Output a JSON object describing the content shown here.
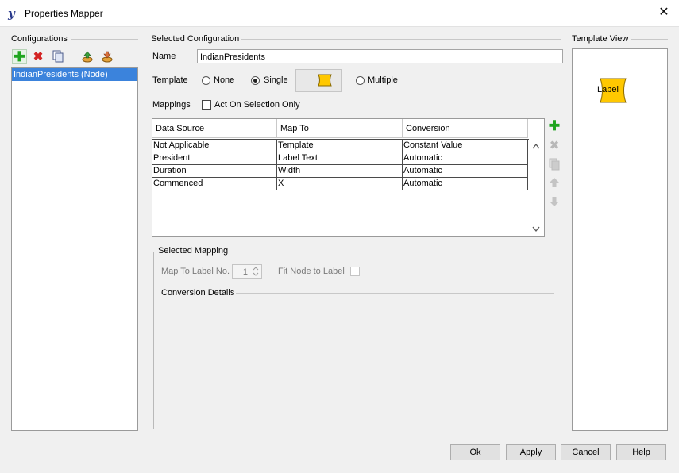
{
  "window": {
    "title": "Properties Mapper",
    "app_icon": "yworks-y-icon",
    "close_glyph": "✕"
  },
  "configurations": {
    "header": "Configurations",
    "toolbar_icons": [
      "add-icon",
      "delete-icon",
      "copy-icon",
      "import-icon",
      "export-icon"
    ],
    "items": [
      "IndianPresidents (Node)"
    ]
  },
  "selected_configuration": {
    "header": "Selected Configuration",
    "name_label": "Name",
    "name_value": "IndianPresidents",
    "template_label": "Template",
    "template_options": {
      "none": "None",
      "single": "Single",
      "multiple": "Multiple"
    },
    "template_selected": "Single",
    "mappings_label": "Mappings",
    "act_on_selection_label": "Act On Selection Only",
    "act_on_selection_checked": false,
    "table": {
      "columns": [
        "Data Source",
        "Map To",
        "Conversion"
      ],
      "rows": [
        [
          "Not Applicable",
          "Template",
          "Constant Value"
        ],
        [
          "President",
          "Label Text",
          "Automatic"
        ],
        [
          "Duration",
          "Width",
          "Automatic"
        ],
        [
          "Commenced",
          "X",
          "Automatic"
        ]
      ]
    },
    "side_icons": [
      "add-mapping-icon",
      "remove-mapping-icon",
      "copy-mapping-icon",
      "move-up-icon",
      "move-down-icon"
    ]
  },
  "selected_mapping": {
    "header": "Selected Mapping",
    "map_to_label_no_label": "Map To Label No.",
    "map_to_label_no_value": "1",
    "fit_node_label": "Fit Node to Label",
    "conversion_details_header": "Conversion Details"
  },
  "template_view": {
    "header": "Template View",
    "node_label": "Label"
  },
  "buttons": {
    "ok": "Ok",
    "apply": "Apply",
    "cancel": "Cancel",
    "help": "Help"
  },
  "colors": {
    "selection": "#3b83dc",
    "node_fill": "#ffc800",
    "node_border": "#8a6a00"
  }
}
